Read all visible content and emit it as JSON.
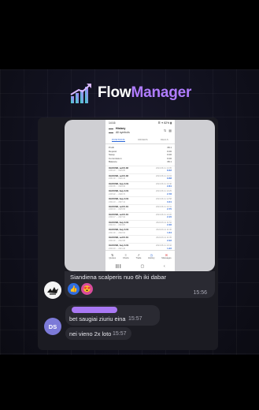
{
  "brand": {
    "flow": "Flow",
    "manager": "Manager",
    "accent": "#b07cff"
  },
  "phone": {
    "status_time": "14:16",
    "status_right": "☰ ✶ 82% ▮",
    "title": "History",
    "subtitle": "All symbols",
    "tabs": [
      "POSITIONS",
      "ORDERS",
      "DEALS"
    ],
    "summary": [
      {
        "label": "Profit",
        "value": "38.1"
      },
      {
        "label": "Deposit",
        "value": "0.00"
      },
      {
        "label": "Swap",
        "value": "0.00"
      },
      {
        "label": "Commission",
        "value": "0.00"
      },
      {
        "label": "Balance",
        "value": "38.1"
      }
    ],
    "trades": [
      {
        "symbol": "XAUUSD, sell 0.02",
        "price": "2330.20 → 2325.85",
        "time": "2024.06.11 14:05",
        "profit": "8.62"
      },
      {
        "symbol": "XAUUSD, sell 0.02",
        "price": "2331.00 → 2326.16",
        "time": "2024.06.11 14:04",
        "profit": "9.68"
      },
      {
        "symbol": "XAUUSD, buy 0.01",
        "price": "2326.65 → 2329.46",
        "time": "2024.06.11 13:40",
        "profit": "2.81"
      },
      {
        "symbol": "XAUUSD, buy 0.01",
        "price": "2325.92 → 2328.70",
        "time": "2024.06.11 13:25",
        "profit": "2.78"
      },
      {
        "symbol": "XAUUSD, buy 0.01",
        "price": "2324.10 → 2327.41",
        "time": "2024.06.11 12:58",
        "profit": "3.31"
      },
      {
        "symbol": "XAUUSD, sell 0.01",
        "price": "2328.33 → 2325.58",
        "time": "2024.06.11 12:41",
        "profit": "2.75"
      },
      {
        "symbol": "XAUUSD, sell 0.01",
        "price": "2329.17 → 2327.02",
        "time": "2024.06.11 12:20",
        "profit": "2.15"
      },
      {
        "symbol": "XAUUSD, buy 0.01",
        "price": "2322.44 → 2324.80",
        "time": "2024.06.11 11:52",
        "profit": "2.36"
      },
      {
        "symbol": "XAUUSD, buy 0.01",
        "price": "2321.00 → 2322.64",
        "time": "2024.06.11 11:30",
        "profit": "1.64"
      },
      {
        "symbol": "XAUUSD, sell 0.01",
        "price": "2324.90 → 2322.88",
        "time": "2024.06.11 11:05",
        "profit": "2.02"
      },
      {
        "symbol": "XAUUSD, buy 0.01",
        "price": "2320.18 → 2321.40",
        "time": "2024.06.11 10:42",
        "profit": "1.22"
      },
      {
        "symbol": "XAUUSD, sell 0.01",
        "price": "2323.60 → 2322.84",
        "time": "2024.06.11 10:10",
        "profit": "0.76"
      }
    ],
    "nav": [
      {
        "label": "Quotes",
        "icon": "⇅"
      },
      {
        "label": "Charts",
        "icon": "≡"
      },
      {
        "label": "Trade",
        "icon": "↗"
      },
      {
        "label": "History",
        "icon": "◷"
      },
      {
        "label": "Messages",
        "icon": "✉"
      }
    ],
    "sys_nav": [
      "∥∥∥",
      "▢",
      "‹"
    ]
  },
  "messages": [
    {
      "text": "Siandiena scalperis nuo 6h iki dabar",
      "time": "15:56",
      "reactions": [
        "👍",
        "😍"
      ]
    },
    {
      "text": "bet saugiai ziuriu eina",
      "time": "15:57"
    },
    {
      "text": "nei vieno 2x loto",
      "time": "15:57"
    }
  ],
  "avatar_initials": "DS"
}
